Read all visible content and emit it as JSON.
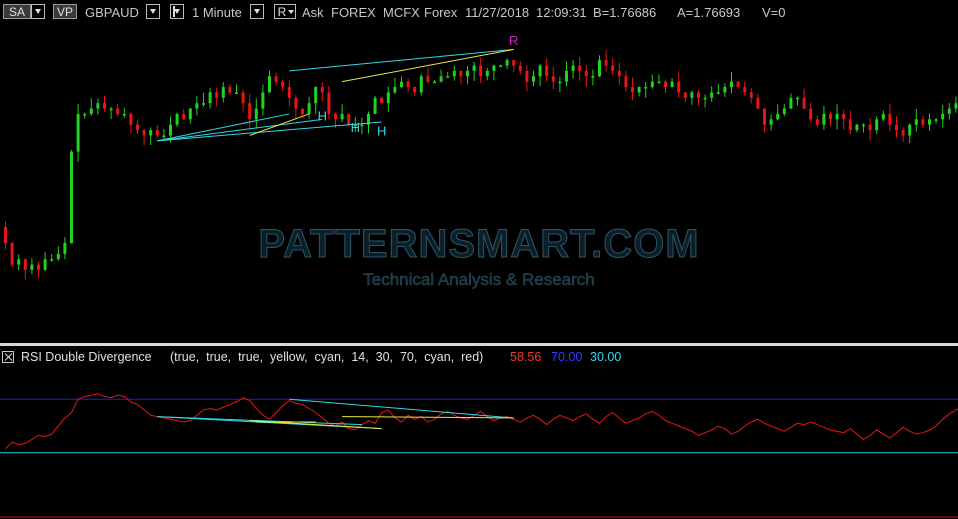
{
  "toolbar": {
    "sa_label": "SA",
    "vp_label": "VP",
    "symbol": "GBPAUD",
    "interval": "1 Minute",
    "r_label": "R",
    "price_type": "Ask",
    "market": "FOREX",
    "feed": "MCFX",
    "category": "Forex",
    "date": "11/27/2018",
    "time": "12:09:31",
    "bid": "B=1.76686",
    "ask": "A=1.76693",
    "volume": "V=0"
  },
  "watermark": {
    "title": "PATTERNSMART.COM",
    "subtitle": "Technical Analysis & Research"
  },
  "indicator": {
    "name": "RSI Double Divergence",
    "params": "(true,  true,  true,  yellow,  cyan,  14,  30,  70,  cyan,  red)",
    "value": "58.56",
    "upper": "70.00",
    "lower": "30.00"
  },
  "colors": {
    "up": "#21d321",
    "down": "#e81515",
    "cyan": "#30d8e8",
    "yellow": "#e8e84a",
    "magenta": "#d21cc8",
    "rsi_line": "#e81515",
    "upper_band": "#1a1ae0",
    "lower_band": "#30d0d8"
  },
  "chart_data": [
    {
      "type": "candlestick",
      "series_name": "GBPAUD",
      "price_min": 1.764,
      "price_max": 1.769,
      "closes": [
        1.7653,
        1.7649,
        1.765,
        1.7648,
        1.7649,
        1.7648,
        1.765,
        1.765,
        1.7651,
        1.7653,
        1.767,
        1.7677,
        1.7677,
        1.7678,
        1.7679,
        1.7678,
        1.7678,
        1.7677,
        1.7677,
        1.7675,
        1.7674,
        1.7673,
        1.7674,
        1.7673,
        1.7673,
        1.7675,
        1.7677,
        1.7676,
        1.7678,
        1.7679,
        1.7679,
        1.7681,
        1.768,
        1.7682,
        1.7681,
        1.7681,
        1.7679,
        1.7676,
        1.7678,
        1.7681,
        1.7684,
        1.7683,
        1.7682,
        1.768,
        1.7678,
        1.7677,
        1.7679,
        1.7682,
        1.7681,
        1.7677,
        1.7676,
        1.7677,
        1.7675,
        1.7675,
        1.7675,
        1.7677,
        1.768,
        1.7679,
        1.7681,
        1.7682,
        1.7683,
        1.7682,
        1.7681,
        1.7684,
        1.7683,
        1.7683,
        1.7684,
        1.7684,
        1.7685,
        1.7684,
        1.7685,
        1.7686,
        1.7684,
        1.7685,
        1.7686,
        1.7686,
        1.7687,
        1.7686,
        1.7685,
        1.7683,
        1.7684,
        1.7686,
        1.7684,
        1.7683,
        1.7683,
        1.7685,
        1.7686,
        1.7685,
        1.7684,
        1.7684,
        1.7687,
        1.7686,
        1.7685,
        1.7684,
        1.7682,
        1.7681,
        1.7682,
        1.7682,
        1.7683,
        1.7683,
        1.7682,
        1.7683,
        1.7681,
        1.768,
        1.7681,
        1.768,
        1.768,
        1.7681,
        1.7681,
        1.7682,
        1.7683,
        1.7682,
        1.7681,
        1.768,
        1.7678,
        1.7675,
        1.7676,
        1.7677,
        1.7678,
        1.768,
        1.768,
        1.7678,
        1.7676,
        1.7675,
        1.7677,
        1.7676,
        1.7677,
        1.7676,
        1.7674,
        1.7675,
        1.7675,
        1.7674,
        1.7676,
        1.7677,
        1.7675,
        1.7674,
        1.7673,
        1.7675,
        1.7676,
        1.7675,
        1.7676,
        1.7676,
        1.7677,
        1.7678,
        1.7679
      ]
    },
    {
      "type": "line",
      "series_name": "RSI",
      "ylim": [
        0,
        100
      ],
      "upper": 70,
      "lower": 30,
      "values": [
        33,
        38,
        36,
        37,
        40,
        43,
        42,
        44,
        50,
        56,
        60,
        70,
        72,
        73,
        74,
        72,
        71,
        73,
        72,
        68,
        66,
        62,
        58,
        57,
        56,
        55,
        54,
        53,
        54,
        58,
        62,
        63,
        62,
        64,
        66,
        68,
        71,
        69,
        63,
        58,
        55,
        60,
        65,
        69,
        67,
        66,
        63,
        60,
        56,
        52,
        50,
        53,
        48,
        47,
        51,
        54,
        52,
        60,
        62,
        56,
        53,
        58,
        55,
        57,
        53,
        55,
        59,
        61,
        58,
        56,
        55,
        58,
        61,
        57,
        54,
        56,
        57,
        55,
        53,
        56,
        58,
        55,
        51,
        55,
        58,
        56,
        54,
        57,
        59,
        55,
        52,
        57,
        60,
        56,
        52,
        54,
        56,
        59,
        61,
        58,
        54,
        52,
        50,
        48,
        46,
        43,
        45,
        47,
        50,
        48,
        44,
        46,
        50,
        53,
        55,
        52,
        50,
        48,
        46,
        49,
        52,
        51,
        53,
        51,
        49,
        47,
        46,
        45,
        48,
        44,
        40,
        43,
        47,
        44,
        41,
        45,
        49,
        46,
        44,
        45,
        47,
        50,
        55,
        59,
        62,
        64
      ]
    }
  ]
}
